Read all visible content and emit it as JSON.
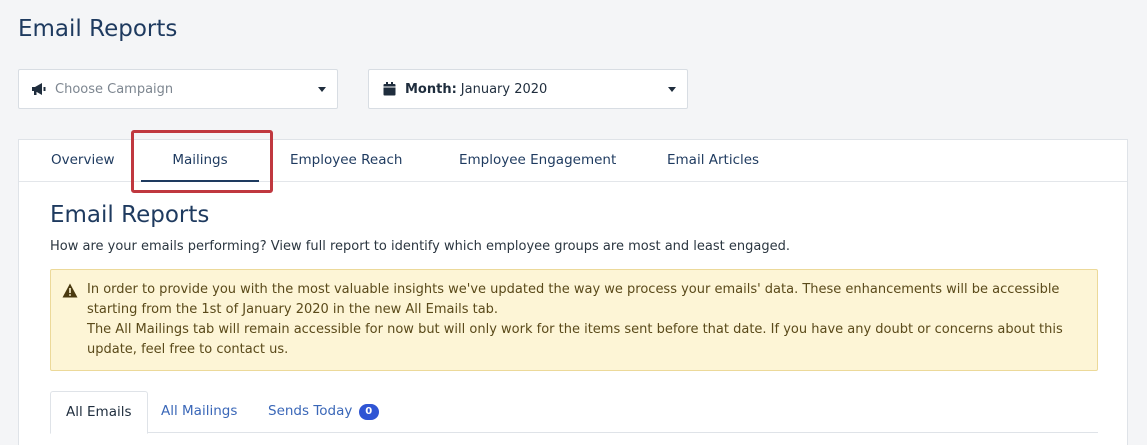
{
  "page": {
    "title": "Email Reports"
  },
  "filters": {
    "campaign": {
      "placeholder": "Choose Campaign",
      "icon": "megaphone-icon"
    },
    "month": {
      "label": "Month:",
      "value": "January 2020",
      "icon": "calendar-icon"
    }
  },
  "tabs": [
    {
      "label": "Overview",
      "active": false
    },
    {
      "label": "Mailings",
      "active": true
    },
    {
      "label": "Employee Reach",
      "active": false
    },
    {
      "label": "Employee Engagement",
      "active": false
    },
    {
      "label": "Email Articles",
      "active": false
    }
  ],
  "section": {
    "title": "Email Reports",
    "description": "How are your emails performing? View full report to identify which employee groups are most and least engaged."
  },
  "alert": {
    "icon": "warning-icon",
    "line1": "In order to provide you with the most valuable insights we've updated the way we process your emails' data. These enhancements will be accessible starting from the 1st of January 2020 in the new All Emails tab.",
    "line2": "The All Mailings tab will remain accessible for now but will only work for the items sent before that date. If you have any doubt or concerns about this update, feel free to contact us."
  },
  "subtabs": [
    {
      "label": "All Emails",
      "active": true
    },
    {
      "label": "All Mailings",
      "active": false
    },
    {
      "label": "Sends Today",
      "active": false,
      "badge": "0"
    }
  ],
  "colors": {
    "accent": "#1e3a5f",
    "highlight": "#c0383f",
    "badge": "#2f55d4",
    "alert_bg": "#fdf5d6"
  }
}
